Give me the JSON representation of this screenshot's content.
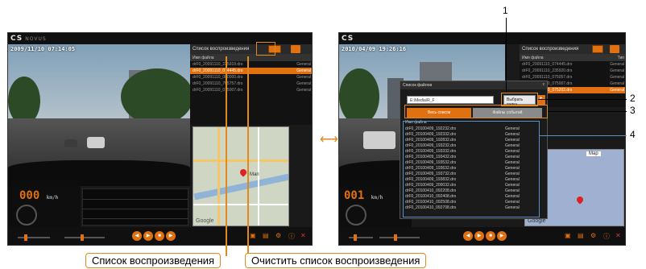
{
  "left_window": {
    "logo": "CS",
    "logo_sub": "NOVUS",
    "timestamp": "2009/11/10 07:14:05",
    "playlist": {
      "title": "Список воспроизведения",
      "col_name": "Имя файла",
      "rows": [
        {
          "name": "drF0_20091110_235919.drs",
          "type": "General",
          "selected": false
        },
        {
          "name": "drF0_20091110_074445.drs",
          "type": "General",
          "selected": true
        },
        {
          "name": "drF0_20091110_000000.drs",
          "type": "General",
          "selected": false
        },
        {
          "name": "drF0_20091110_705757.drs",
          "type": "General",
          "selected": false
        },
        {
          "name": "drF0_20091110_075007.drs",
          "type": "General",
          "selected": false
        }
      ]
    },
    "speed": "000",
    "speed_unit": "km/h",
    "map_label": "Мап",
    "map_brand": "Google"
  },
  "right_window": {
    "logo": "CS",
    "timestamp": "2010/04/09 19:26:16",
    "playlist": {
      "title": "Список воспроизведения",
      "col_name": "Имя файла",
      "col_type": "Тип",
      "rows": [
        {
          "name": "drF0_20091110_074445.drs",
          "type": "General"
        },
        {
          "name": "drF0_20091110_235920.drs",
          "type": "General"
        },
        {
          "name": "drF0_20091110_075057.drs",
          "type": "General"
        },
        {
          "name": "drF0_20091110_075007.drs",
          "type": "General"
        },
        {
          "name": "drF0_20091110_075202.drs",
          "type": "General"
        }
      ]
    },
    "speed": "001",
    "speed_unit": "km/h",
    "map_label": "Map",
    "map_brand": "Google"
  },
  "dialog": {
    "title": "Список файлов",
    "close": "x",
    "path": "E:\\Media\\R_F",
    "choose_folder": "Выбрать папку",
    "tab_all": "Весь список",
    "tab_event": "Файлы событий",
    "list_header": "Имя файла",
    "files": [
      {
        "name": "drF0_20100409_192232.drs",
        "type": "General"
      },
      {
        "name": "drF0_20100409_192332.drs",
        "type": "General"
      },
      {
        "name": "drF0_20100409_192832.drs",
        "type": "General"
      },
      {
        "name": "drF0_20100409_193232.drs",
        "type": "General"
      },
      {
        "name": "drF0_20100409_193332.drs",
        "type": "General"
      },
      {
        "name": "drF0_20100409_193432.drs",
        "type": "General"
      },
      {
        "name": "drF0_20100409_193532.drs",
        "type": "General"
      },
      {
        "name": "drF0_20100409_193632.drs",
        "type": "General"
      },
      {
        "name": "drF0_20100409_193732.drs",
        "type": "General"
      },
      {
        "name": "drF0_20100409_193832.drs",
        "type": "General"
      },
      {
        "name": "drF0_20100409_200032.drs",
        "type": "General"
      },
      {
        "name": "drF0_20100410_092208.drs",
        "type": "General"
      },
      {
        "name": "drF0_20100410_092408.drs",
        "type": "General"
      },
      {
        "name": "drF0_20100410_092508.drs",
        "type": "General"
      },
      {
        "name": "drF0_20100410_092708.drs",
        "type": "General"
      }
    ]
  },
  "callouts": {
    "n1": "1",
    "n2": "2",
    "n3": "3",
    "n4": "4"
  },
  "captions": {
    "playlist": "Список воспроизведения",
    "clear_playlist": "Очистить список воспроизведения"
  },
  "colors": {
    "accent": "#e07010",
    "highlight": "#e08a1e"
  }
}
